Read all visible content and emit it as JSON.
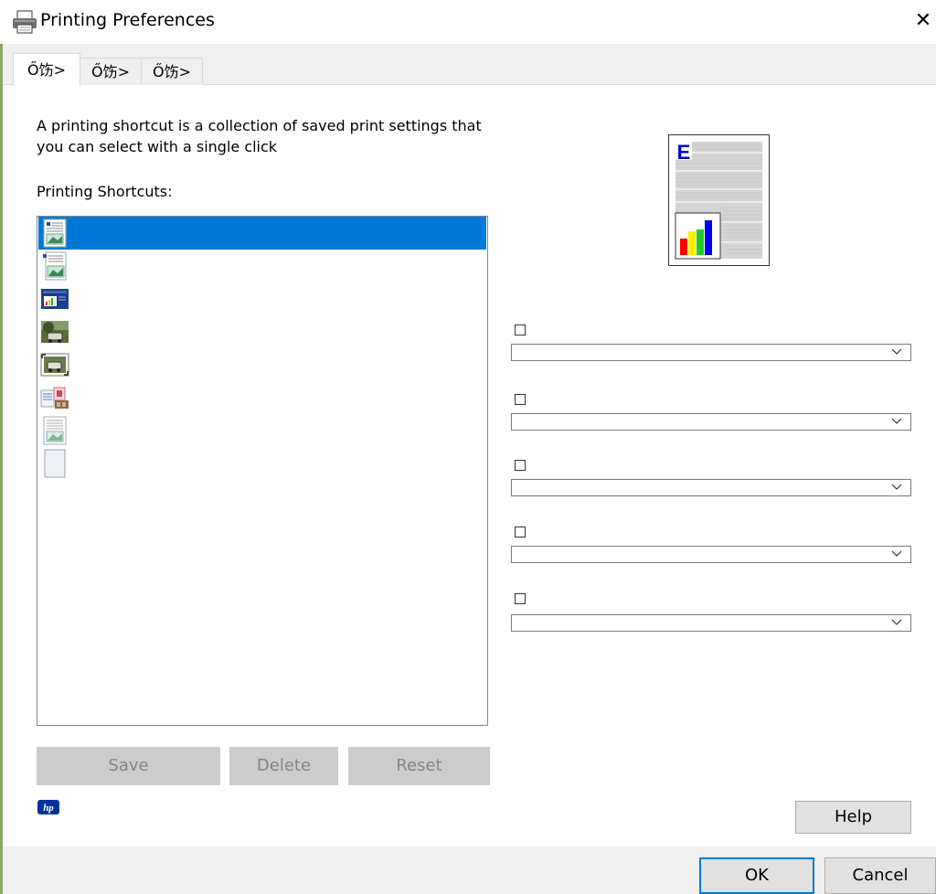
{
  "window": {
    "title": "Printing Preferences",
    "close_symbol": "✕"
  },
  "tabs": [
    {
      "label": "Ő饬>",
      "active": true
    },
    {
      "label": "Ő饬>",
      "active": false
    },
    {
      "label": "Ő饬>",
      "active": false
    }
  ],
  "shortcuts_panel": {
    "description": "A printing shortcut is a collection of saved print settings that you can select with a single click",
    "list_label": "Printing Shortcuts:",
    "items": [
      {
        "icon": "document-with-image-icon",
        "selected": true
      },
      {
        "icon": "document-with-image-icon",
        "selected": false
      },
      {
        "icon": "presentation-icon",
        "selected": false
      },
      {
        "icon": "photo-icon",
        "selected": false
      },
      {
        "icon": "photo-bordered-icon",
        "selected": false
      },
      {
        "icon": "brochure-icon",
        "selected": false
      },
      {
        "icon": "document-with-image-icon",
        "selected": false
      },
      {
        "icon": "blank-page-icon",
        "selected": false
      }
    ],
    "buttons": {
      "save": "Save",
      "delete": "Delete",
      "reset": "Reset"
    }
  },
  "settings_panel": {
    "rows": [
      {
        "checked": false,
        "value": ""
      },
      {
        "checked": false,
        "value": ""
      },
      {
        "checked": false,
        "value": ""
      },
      {
        "checked": false,
        "value": ""
      },
      {
        "checked": false,
        "value": ""
      }
    ]
  },
  "footer": {
    "help": "Help",
    "ok": "OK",
    "cancel": "Cancel",
    "logo_text": "hp"
  },
  "colors": {
    "selection": "#0078d7",
    "accent_border": "#0078d7",
    "hp_blue": "#0033a0"
  }
}
